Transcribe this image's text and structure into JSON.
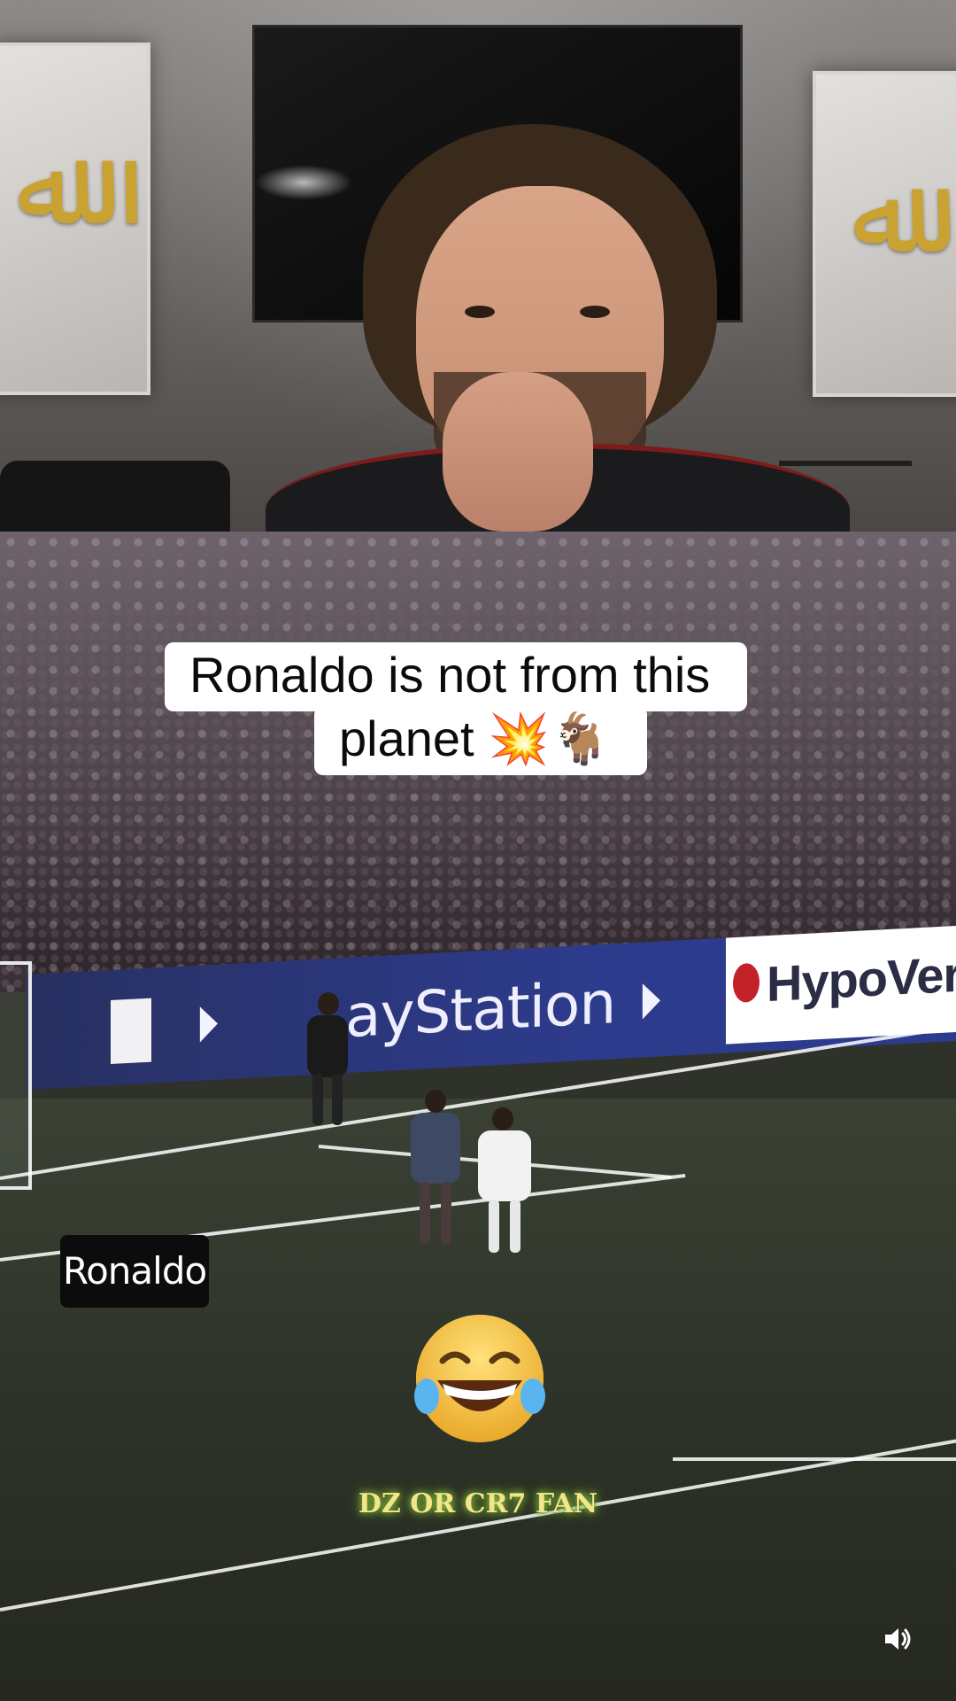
{
  "caption": {
    "line1": "Ronaldo is not from this",
    "line2": "planet 💥🐐"
  },
  "video": {
    "name_tag": "Ronaldo",
    "board_text": "ayStation",
    "board_sponsor": "HypoVerein",
    "watermark": "DZ OR CR7 FAN",
    "emoji": "😂"
  },
  "controls": {
    "volume_icon": "speaker-icon"
  }
}
